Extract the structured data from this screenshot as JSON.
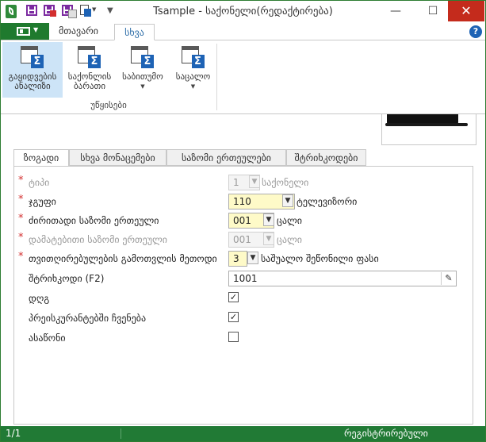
{
  "window": {
    "title": "Tsample - საქონელი(რედაქტირება)",
    "controls": {
      "minimize": "—",
      "maximize": "☐",
      "close": "✕"
    }
  },
  "ribbon": {
    "tabs": [
      {
        "label": "მთავარი"
      },
      {
        "label": "სხვა"
      }
    ],
    "help": "?",
    "buttons": [
      {
        "label1": "გაყიდვების",
        "label2": "ანალიზი",
        "icon": "table-sigma-icon"
      },
      {
        "label1": "საქონლის",
        "label2": "ბარათი",
        "icon": "table-sigma-icon"
      },
      {
        "label1": "საბითუმო",
        "label2": "",
        "icon": "table-sigma-icon",
        "dropdown": "▼"
      },
      {
        "label1": "საცალო",
        "label2": "",
        "icon": "table-sigma-icon",
        "dropdown": "▼"
      }
    ],
    "group_label": "უწყისები"
  },
  "form": {
    "tabs": [
      "ზოგადი",
      "სხვა მონაცემები",
      "საზომი ერთეულები",
      "შტრიხკოდები"
    ],
    "fields": {
      "type": {
        "label": "ტიპი",
        "value": "1",
        "after": "საქონელი"
      },
      "group": {
        "label": "ჯგუფი",
        "value": "110",
        "after": "ტელევიზორი"
      },
      "main_unit": {
        "label": "ძირითადი საზომი ერთეული",
        "value": "001",
        "after": "ცალი"
      },
      "extra_unit": {
        "label": "დამატებითი საზომი ერთეული",
        "value": "001",
        "after": "ცალი"
      },
      "cost_method": {
        "label": "თვითღირებულების გამოთვლის მეთოდი",
        "value": "3",
        "after": "საშუალო შეწონილი ფასი"
      },
      "barcode": {
        "label": "შტრიხკოდი (F2)",
        "value": "1001"
      },
      "vat": {
        "label": "დღგ",
        "checked": true
      },
      "show_in_pricelists": {
        "label": "პრეისკურანტებში ჩვენება",
        "checked": true
      },
      "weighable": {
        "label": "ასაწონი",
        "checked": false
      }
    }
  },
  "status": {
    "page": "1/1",
    "state": "რეგისტრირებული"
  },
  "colors": {
    "accent_green": "#217a35",
    "required_star": "#d32f2f",
    "input_highlight": "#fefac8",
    "sigma_blue": "#1e63b5"
  }
}
